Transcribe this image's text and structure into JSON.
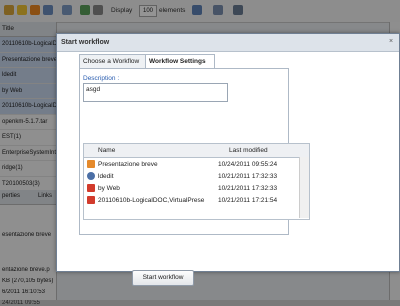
{
  "toolbar": {
    "display_label": "Display",
    "display_value": "100",
    "elements_label": "elements",
    "icons": [
      "folder-open-icon",
      "star-icon",
      "rss-icon",
      "view-icon",
      "list-icon",
      "refresh-icon",
      "print-icon",
      "filter-icon",
      "save-icon",
      "settings-icon"
    ]
  },
  "left_panel": {
    "header": "Title",
    "rows": [
      "20110610b-LogicalD",
      "Presentazione breve",
      "ldedit",
      "by Web",
      "20110610b-LogicalD",
      "openkm-5.1.7.tar",
      "EST(1)",
      "EnterpriseSystemInt",
      "ridge(1)",
      "T20100503(3)"
    ],
    "tabs": [
      "perties",
      "Links"
    ],
    "lower_items": [
      "esentazione breve",
      "entazione breve.p",
      "KB (270,105 bytes)",
      "6/2011 16:10:53",
      "24/2011 09:55"
    ]
  },
  "dialog": {
    "title": "Start workflow",
    "close_glyph": "×",
    "tabs": [
      "Choose a Workflow",
      "Workflow Settings"
    ],
    "description_label": "Description :",
    "description_value": "asgd",
    "grid": {
      "columns": [
        "Name",
        "Last modified"
      ],
      "rows": [
        {
          "name": "Presentazione breve",
          "modified": "10/24/2011 09:55:24",
          "icon": "ppt-file-icon",
          "color": "#e58a2c"
        },
        {
          "name": "ldedit",
          "modified": "10/21/2011 17:32:33",
          "icon": "generic-file-icon",
          "color": "#4b6fa6"
        },
        {
          "name": "by Web",
          "modified": "10/21/2011 17:32:33",
          "icon": "pdf-file-icon",
          "color": "#d23b2c"
        },
        {
          "name": "20110610b-LogicalDOC,VirtualPrese",
          "modified": "10/21/2011 17:21:54",
          "icon": "pdf-file-icon",
          "color": "#d23b2c"
        }
      ]
    },
    "start_button": "Start workflow"
  }
}
